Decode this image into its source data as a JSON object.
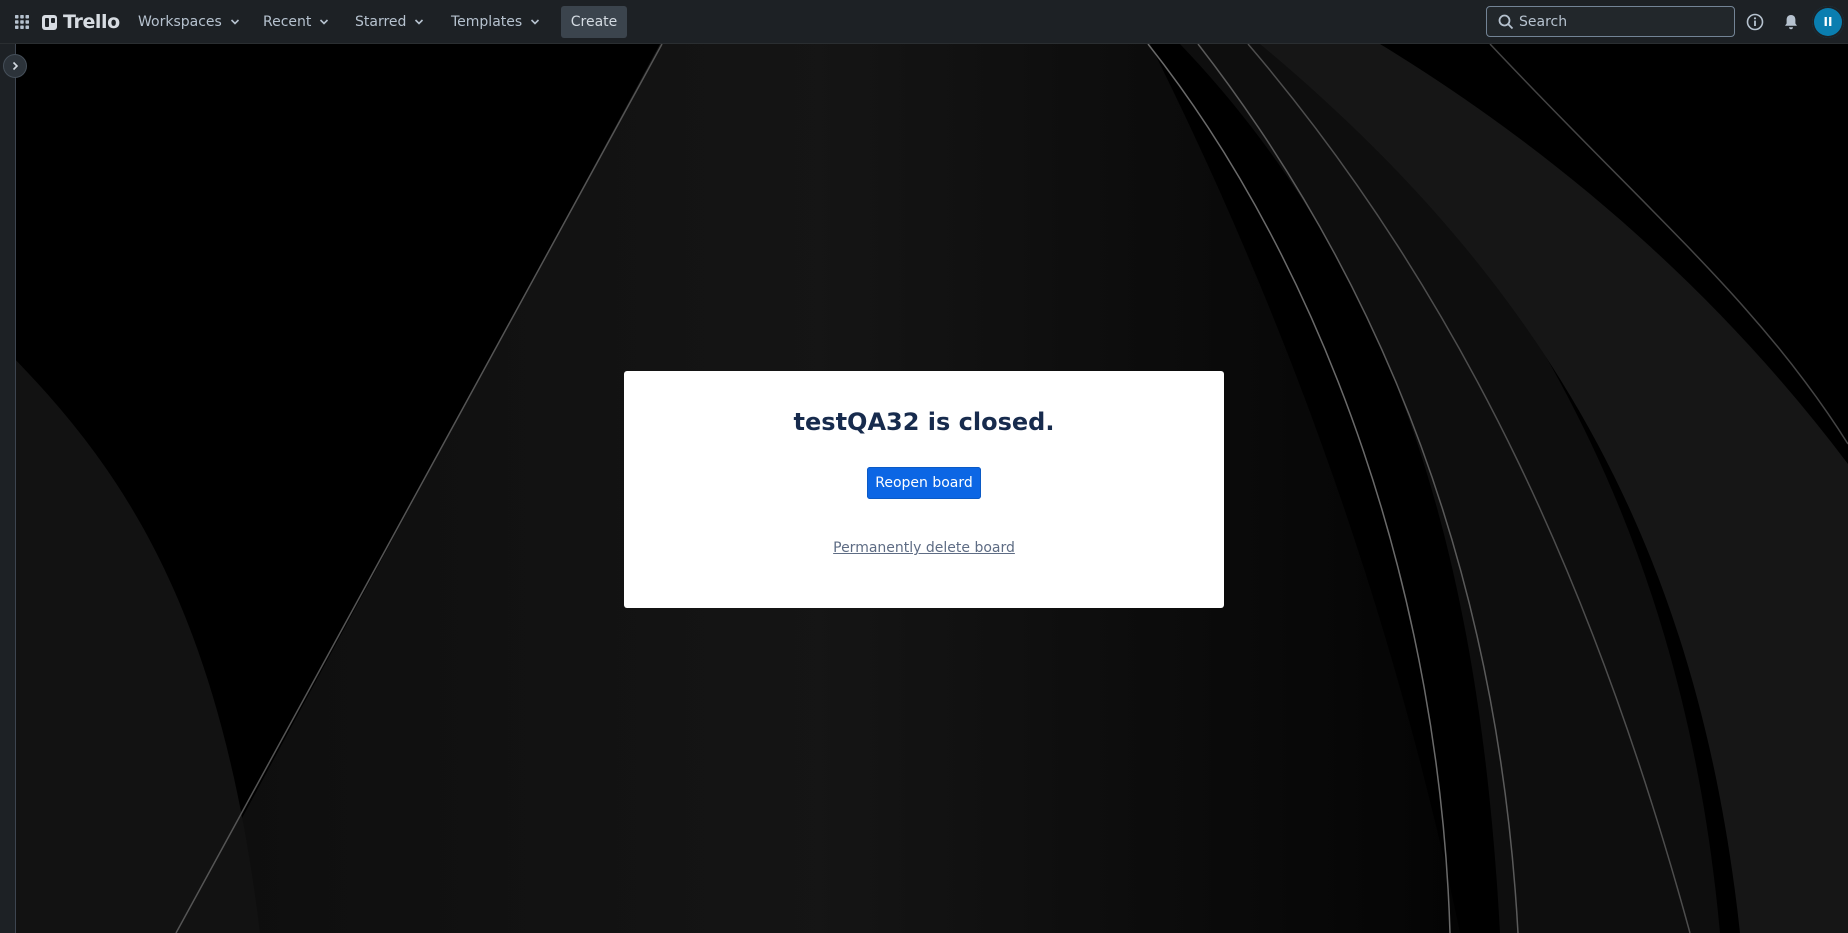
{
  "header": {
    "apps_icon": "grid-icon",
    "logo_text": "Trello",
    "nav": [
      {
        "label": "Workspaces"
      },
      {
        "label": "Recent"
      },
      {
        "label": "Starred"
      },
      {
        "label": "Templates"
      }
    ],
    "create_label": "Create",
    "search_placeholder": "Search",
    "icons": [
      "info-icon",
      "bell-icon"
    ],
    "avatar_initials": "II",
    "avatar_color": "#0a7eb0"
  },
  "modal": {
    "title": "testQA32 is closed.",
    "reopen_label": "Reopen board",
    "delete_label": "Permanently delete board",
    "button_color": "#0c66e4"
  }
}
